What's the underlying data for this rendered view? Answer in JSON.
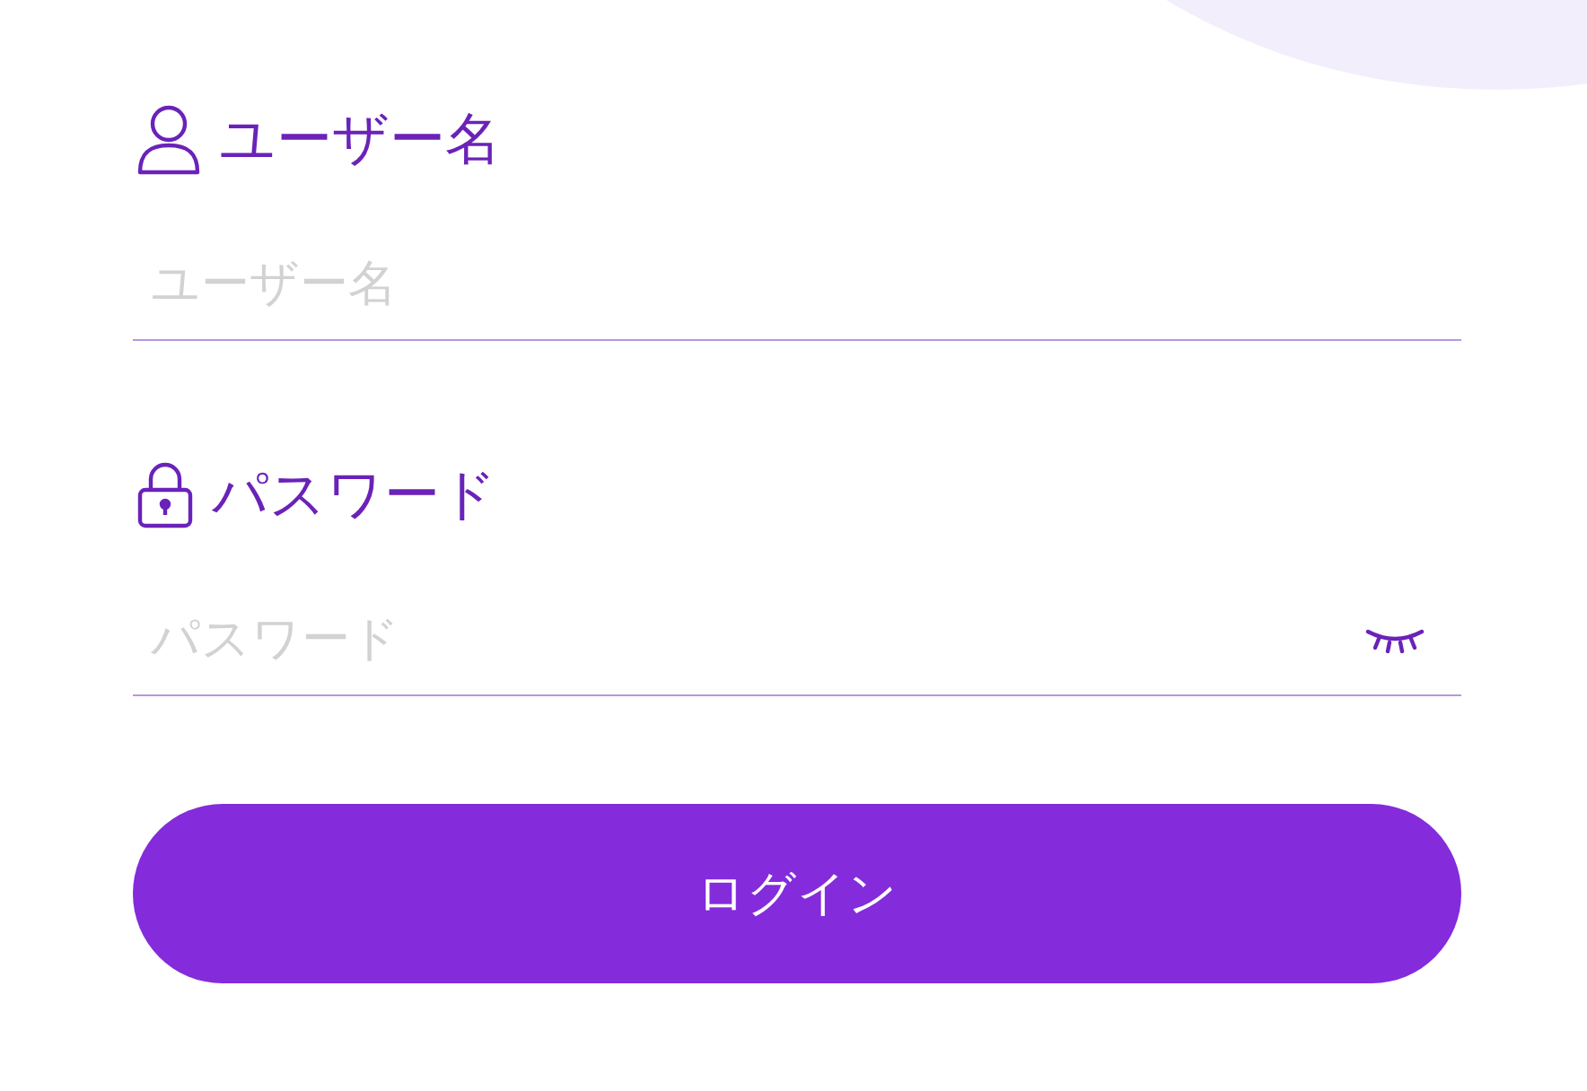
{
  "fields": [
    {
      "label": "ユーザー名",
      "placeholder": "ユーザー名",
      "kind": "text"
    },
    {
      "label": "パスワード",
      "placeholder": "パスワード",
      "kind": "password"
    }
  ],
  "submit": {
    "label": "ログイン"
  }
}
